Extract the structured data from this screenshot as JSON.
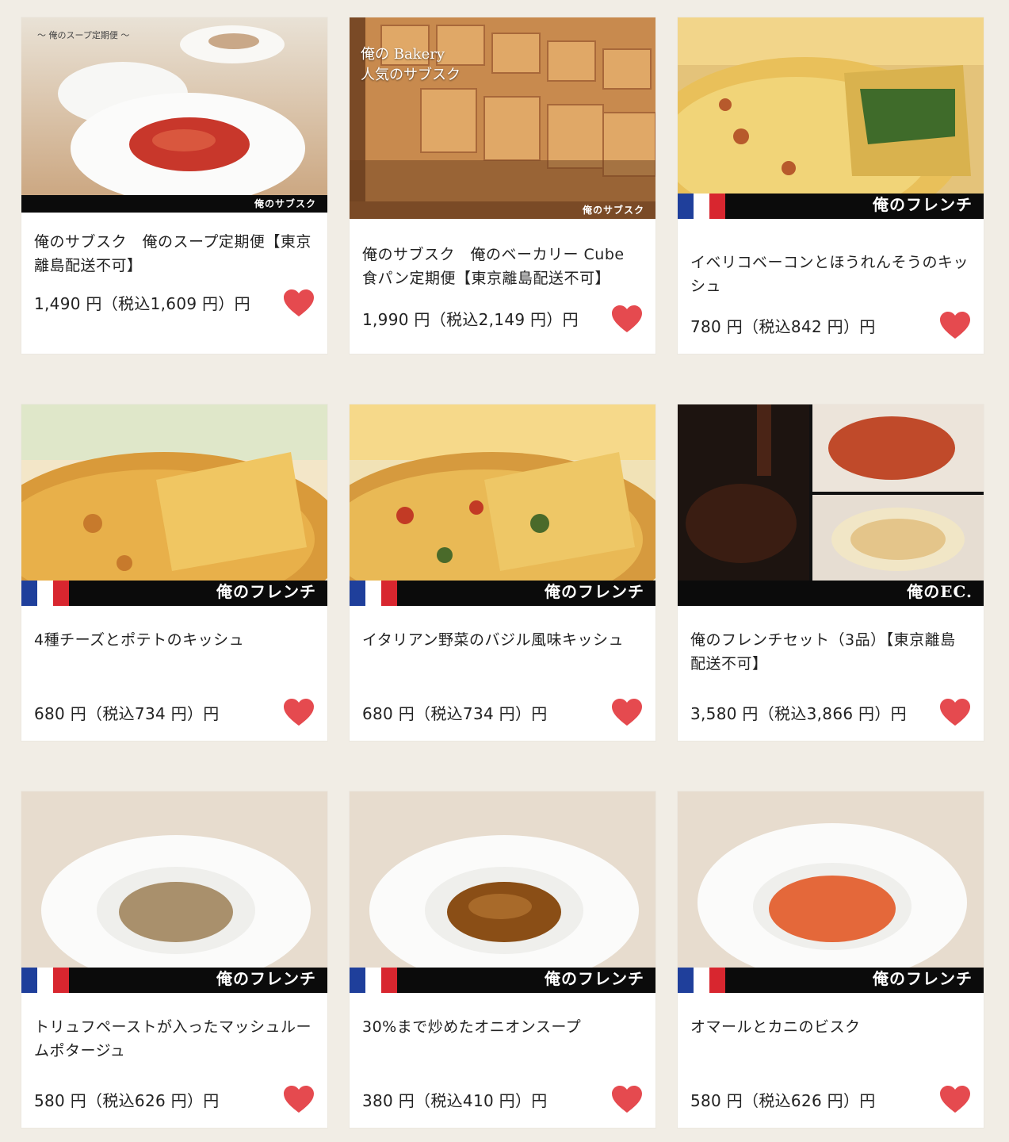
{
  "colors": {
    "background": "#f1ede5",
    "card": "#ffffff",
    "heart": "#e54a4f",
    "band": "#0b0b0b"
  },
  "products": [
    {
      "name": "俺のサブスク　俺のスープ定期便【東京離島配送不可】",
      "price": "1,490 円（税込1,609 円）円",
      "brand": "俺のサブスク",
      "image_caption": "～ 俺のスープ定期便 ～",
      "icon": "heart-icon"
    },
    {
      "name": "俺のサブスク　俺のベーカリー Cube 食パン定期便【東京離島配送不可】",
      "price": "1,990 円（税込2,149 円）円",
      "brand": "俺のサブスク",
      "image_caption_1": "俺の Bakery",
      "image_caption_2": "人気のサブスク",
      "icon": "heart-icon"
    },
    {
      "name": "イベリコベーコンとほうれんそうのキッシュ",
      "price": "780 円（税込842 円）円",
      "brand": "俺のフレンチ",
      "icon": "heart-icon"
    },
    {
      "name": "4種チーズとポテトのキッシュ",
      "price": "680 円（税込734 円）円",
      "brand": "俺のフレンチ",
      "icon": "heart-icon"
    },
    {
      "name": "イタリアン野菜のバジル風味キッシュ",
      "price": "680 円（税込734 円）円",
      "brand": "俺のフレンチ",
      "icon": "heart-icon"
    },
    {
      "name": "俺のフレンチセット（3品）【東京離島配送不可】",
      "price": "3,580 円（税込3,866 円）円",
      "brand": "俺のEC.",
      "icon": "heart-icon"
    },
    {
      "name": "トリュフペーストが入ったマッシュルームポタージュ",
      "price": "580 円（税込626 円）円",
      "brand": "俺のフレンチ",
      "icon": "heart-icon"
    },
    {
      "name": "30%まで炒めたオニオンスープ",
      "price": "380 円（税込410 円）円",
      "brand": "俺のフレンチ",
      "icon": "heart-icon"
    },
    {
      "name": "オマールとカニのビスク",
      "price": "580 円（税込626 円）円",
      "brand": "俺のフレンチ",
      "icon": "heart-icon"
    }
  ]
}
